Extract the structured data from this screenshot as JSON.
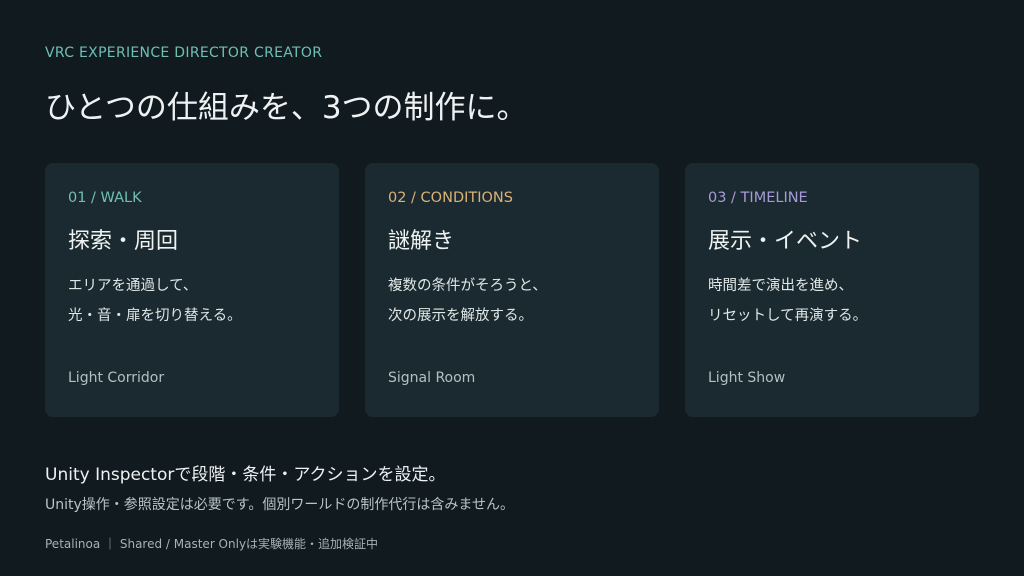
{
  "eyebrow": "VRC EXPERIENCE DIRECTOR CREATOR",
  "title": "ひとつの仕組みを、3つの制作に。",
  "cards": [
    {
      "tag": "01 / WALK",
      "tag_color": "#6fbfb5",
      "title": "探索・周回",
      "desc_line1": "エリアを通過して、",
      "desc_line2": "光・音・扉を切り替える。",
      "foot": "Light Corridor"
    },
    {
      "tag": "02 / CONDITIONS",
      "tag_color": "#d9b276",
      "title": "謎解き",
      "desc_line1": "複数の条件がそろうと、",
      "desc_line2": "次の展示を解放する。",
      "foot": "Signal Room"
    },
    {
      "tag": "03 / TIMELINE",
      "tag_color": "#a89ad9",
      "title": "展示・イベント",
      "desc_line1": "時間差で演出を進め、",
      "desc_line2": "リセットして再演する。",
      "foot": "Light Show"
    }
  ],
  "footer": {
    "line1": "Unity Inspectorで段階・条件・アクションを設定。",
    "line2": "Unity操作・参照設定は必要です。個別ワールドの制作代行は含みません。",
    "line3": "Petalinoa ｜ Shared / Master Onlyは実験機能・追加検証中"
  }
}
